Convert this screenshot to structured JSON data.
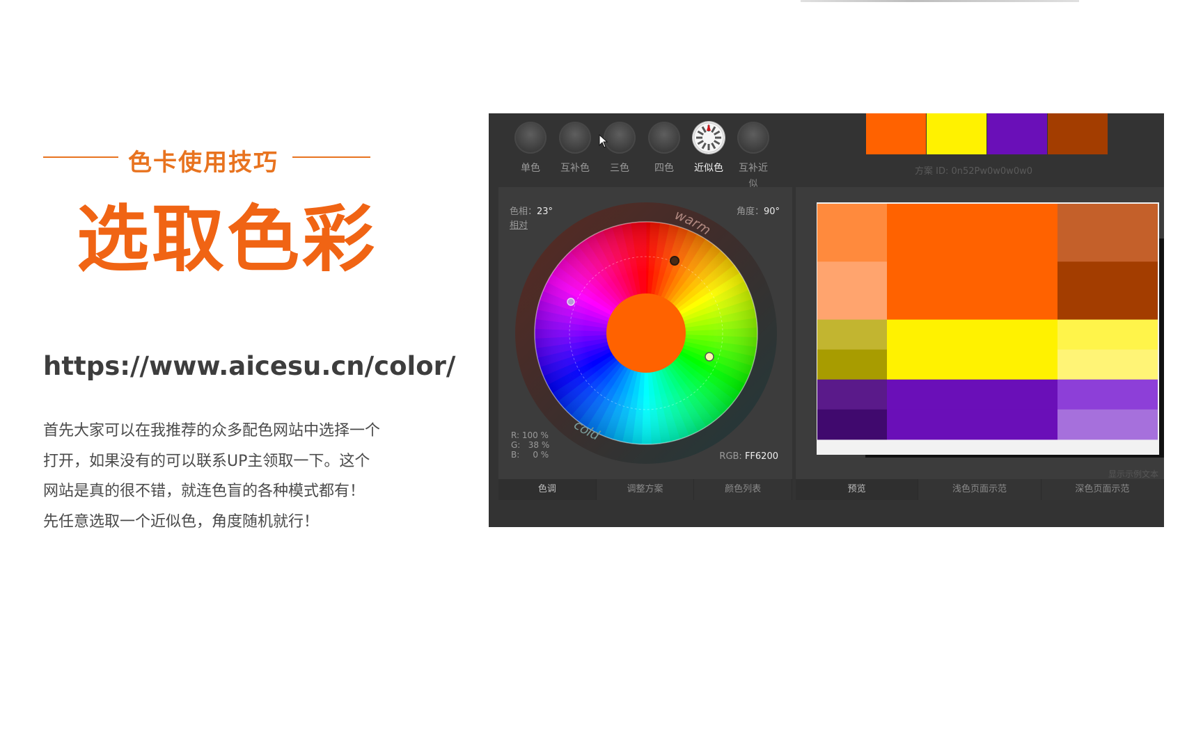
{
  "slide": {
    "subtitle": "色卡使用技巧",
    "title": "选取色彩",
    "url": "https://www.aicesu.cn/color/",
    "description": [
      "首先大家可以在我推荐的众多配色网站中选择一个",
      "打开，如果没有的可以联系UP主领取一下。这个",
      "网站是真的很不错，就连色盲的各种模式都有！",
      "先任意选取一个近似色，角度随机就行！"
    ]
  },
  "tool": {
    "modes": [
      {
        "label": "单色"
      },
      {
        "label": "互补色"
      },
      {
        "label": "三色"
      },
      {
        "label": "四色"
      },
      {
        "label": "近似色"
      },
      {
        "label": "互补近",
        "label2": "似"
      }
    ],
    "active_mode": "近似色",
    "top_swatches": [
      "#ff6200",
      "#fff200",
      "#6a0fb8",
      "#a33d00"
    ],
    "scheme_id": "方案 ID: 0n52Pw0w0w0w0",
    "hue_label": "色相：",
    "hue_value": "23°",
    "relative_label": "相对",
    "angle_label": "角度：",
    "angle_value": "90°",
    "wheel_warm": "warm",
    "wheel_cold": "cold",
    "rgb_r": "R: 100 %",
    "rgb_g": "G:   38 %",
    "rgb_b": "B:     0 %",
    "rgb_hex_label": "RGB: ",
    "rgb_hex_value": "FF6200",
    "center_color": "#ff6200",
    "left_tabs": [
      "色调",
      "调整方案",
      "颜色列表"
    ],
    "right_tabs": [
      "预览",
      "浅色页面示范",
      "深色页面示范"
    ],
    "sample_text": "显示示例文本",
    "preview_rows": [
      {
        "h": 0.232,
        "cells": [
          "#ff8a3d",
          "#ff6200",
          "#c4602a"
        ]
      },
      {
        "h": 0.232,
        "cells": [
          "#ffa46e",
          "#ff6200",
          "#a33d00"
        ]
      },
      {
        "h": 0.12,
        "cells": [
          "#c2b530",
          "#fff200",
          "#fff44a"
        ]
      },
      {
        "h": 0.12,
        "cells": [
          "#a89c00",
          "#fff200",
          "#fff476"
        ]
      },
      {
        "h": 0.12,
        "cells": [
          "#5a1a8a",
          "#6a0fb8",
          "#8d3fd8"
        ]
      },
      {
        "h": 0.12,
        "cells": [
          "#40096e",
          "#6a0fb8",
          "#a670dc"
        ]
      }
    ]
  }
}
